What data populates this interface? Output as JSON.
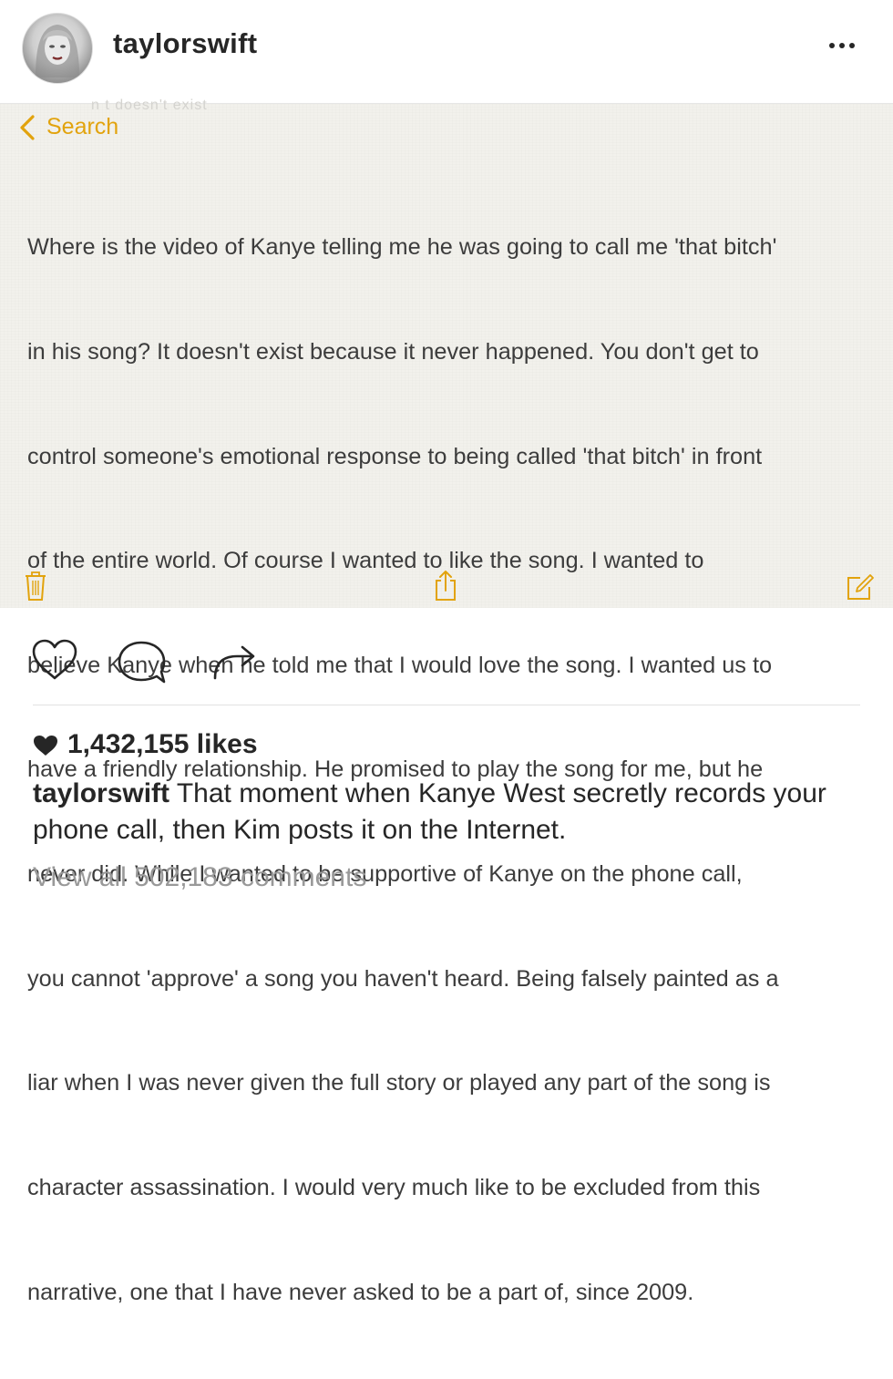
{
  "header": {
    "username": "taylorswift",
    "avatar_icon": "profile-photo",
    "more_icon": "ellipsis-icon"
  },
  "note": {
    "ghost_text": "n t doesn't exist",
    "back_label": "Search",
    "body_lines": [
      "Where is the video of Kanye telling me he was going to call me 'that bitch'",
      "in his song? It doesn't exist because it never happened. You don't get to",
      "control someone's emotional response to being called 'that bitch' in front",
      "of the entire world. Of course I wanted to like the song. I wanted to",
      "believe Kanye when he told me that I would love the song. I wanted us to",
      "have a friendly relationship. He promised to play the song for me, but he",
      "never did. While I wanted to be supportive of Kanye on the phone call,",
      "you cannot 'approve' a song you haven't heard. Being falsely painted as a",
      "liar when I was never given the full story or played any part of the song is",
      "character assassination. I would very much like to be excluded from this",
      "narrative, one that I have never asked to be a part of, since 2009."
    ],
    "toolbar": [
      "trash-icon",
      "share-icon",
      "compose-icon"
    ],
    "accent_color": "#e2a30d"
  },
  "actions": {
    "icons": [
      "heart-icon",
      "comment-icon",
      "share-arrow-icon"
    ]
  },
  "likes": {
    "text": "1,432,155 likes"
  },
  "caption": {
    "user": "taylorswift",
    "text": " That moment when Kanye West secretly records your phone call, then Kim posts it on the Internet."
  },
  "comments": {
    "link_text": "View all 502,183 comments"
  }
}
